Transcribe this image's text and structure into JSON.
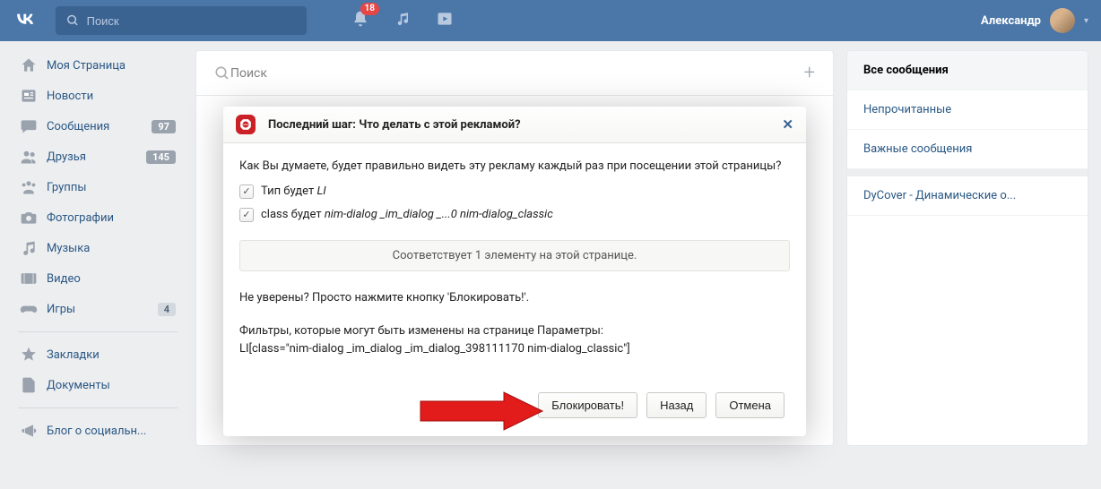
{
  "header": {
    "search_placeholder": "Поиск",
    "notif_count": "18",
    "username": "Александр"
  },
  "sidebar": {
    "items": [
      {
        "label": "Моя Страница",
        "icon": "home"
      },
      {
        "label": "Новости",
        "icon": "news"
      },
      {
        "label": "Сообщения",
        "icon": "chat",
        "badge": "97"
      },
      {
        "label": "Друзья",
        "icon": "friends",
        "badge": "145"
      },
      {
        "label": "Группы",
        "icon": "groups"
      },
      {
        "label": "Фотографии",
        "icon": "photo"
      },
      {
        "label": "Музыка",
        "icon": "music"
      },
      {
        "label": "Видео",
        "icon": "video"
      },
      {
        "label": "Игры",
        "icon": "games",
        "badge": "4",
        "light": true
      }
    ],
    "extra": [
      {
        "label": "Закладки",
        "icon": "star"
      },
      {
        "label": "Документы",
        "icon": "doc"
      }
    ],
    "blog": "Блог о социальн..."
  },
  "center": {
    "search_placeholder": "Поиск"
  },
  "dialog": {
    "title": "Последний шаг: Что делать с этой рекламой?",
    "question": "Как Вы думаете, будет правильно видеть эту рекламу каждый раз при посещении этой страницы?",
    "chk1_pre": "Тип будет ",
    "chk1_em": "LI",
    "chk2_pre": "class будет ",
    "chk2_em": "nim-dialog _im_dialog _...0 nim-dialog_classic",
    "match": "Соответствует 1 элементу на этой странице.",
    "unsure": "Не уверены? Просто нажмите кнопку 'Блокировать!'.",
    "filters_pre": "Фильтры, которые могут быть изменены на странице Параметры:",
    "filters_code": "LI[class=\"nim-dialog _im_dialog _im_dialog_398111170 nim-dialog_classic\"]",
    "btn_block": "Блокировать!",
    "btn_back": "Назад",
    "btn_cancel": "Отмена"
  },
  "right": {
    "tabs": [
      "Все сообщения",
      "Непрочитанные",
      "Важные сообщения"
    ],
    "dycover": "DyCover - Динамические о..."
  }
}
